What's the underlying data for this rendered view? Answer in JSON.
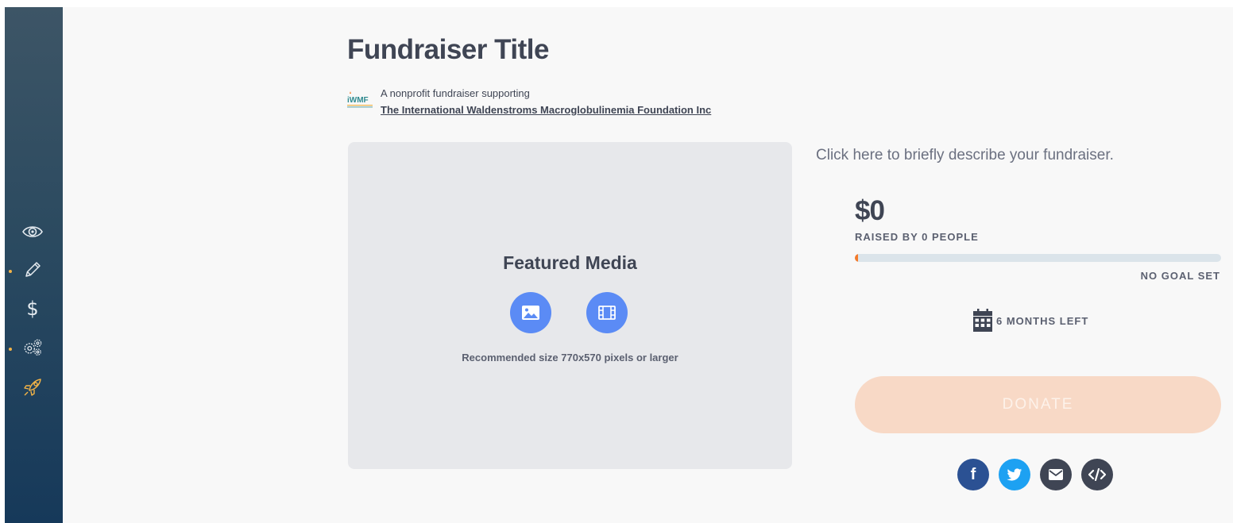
{
  "sidebar": {
    "items": [
      {
        "icon": "eye-icon",
        "label": "Preview"
      },
      {
        "icon": "pencil-icon",
        "label": "Edit"
      },
      {
        "icon": "dollar-icon",
        "label": "Donations"
      },
      {
        "icon": "gears-icon",
        "label": "Settings"
      },
      {
        "icon": "rocket-icon",
        "label": "Launch"
      }
    ],
    "accent_color": "#f2b347"
  },
  "fundraiser": {
    "title": "Fundraiser Title",
    "org_subtitle": "A nonprofit fundraiser supporting",
    "org_name": "The International Waldenstroms Macroglobulinemia Foundation Inc",
    "org_logo_text": "iWMF",
    "description_placeholder": "Click here to briefly describe your fundraiser."
  },
  "media": {
    "title": "Featured Media",
    "note": "Recommended size 770x570 pixels or larger",
    "buttons": [
      {
        "icon": "image-icon"
      },
      {
        "icon": "film-icon"
      }
    ]
  },
  "stats": {
    "raised": "$0",
    "raised_by": "RAISED BY 0 PEOPLE",
    "progress_percent": 0,
    "goal": "NO GOAL SET",
    "time_left": "6 MONTHS LEFT"
  },
  "donate": {
    "label": "DONATE",
    "color": "#f8d9c6"
  },
  "share": [
    {
      "icon": "facebook-icon",
      "color": "#2b5193"
    },
    {
      "icon": "twitter-icon",
      "color": "#1da1f2"
    },
    {
      "icon": "email-icon",
      "color": "#3f4554"
    },
    {
      "icon": "embed-code-icon",
      "color": "#3f4554"
    }
  ]
}
